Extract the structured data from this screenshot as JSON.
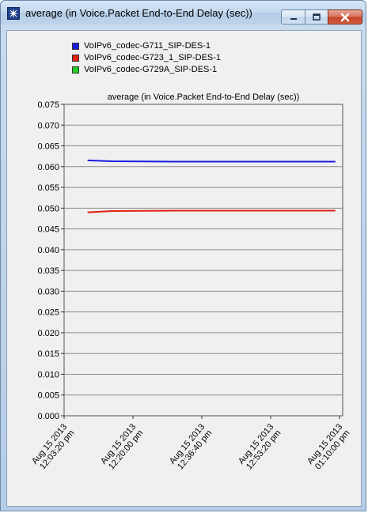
{
  "window": {
    "title": "average (in Voice.Packet End-to-End Delay (sec))",
    "icon": "app-window-icon",
    "controls": [
      "minimize-icon",
      "maximize-icon",
      "close-icon"
    ]
  },
  "legend": [
    {
      "name": "VoIPv6_codec-G711_SIP-DES-1",
      "color": "#1a1adf"
    },
    {
      "name": "VoIPv6_codec-G723_1_SIP-DES-1",
      "color": "#e02010"
    },
    {
      "name": "VoIPv6_codec-G729A_SIP-DES-1",
      "color": "#22cc22"
    }
  ],
  "chart_data": {
    "type": "line",
    "title": "average (in Voice.Packet End-to-End Delay (sec))",
    "xlabel": "",
    "ylabel": "",
    "ylim": [
      0,
      0.075
    ],
    "yticks": [
      "0.000",
      "0.005",
      "0.010",
      "0.015",
      "0.020",
      "0.025",
      "0.030",
      "0.035",
      "0.040",
      "0.045",
      "0.050",
      "0.055",
      "0.060",
      "0.065",
      "0.070",
      "0.075"
    ],
    "xticks": [
      {
        "date": "Aug 15 2013",
        "time": "12:03:20 pm"
      },
      {
        "date": "Aug 15 2013",
        "time": "12:20:00 pm"
      },
      {
        "date": "Aug 15 2013",
        "time": "12:36:40 pm"
      },
      {
        "date": "Aug 15 2013",
        "time": "12:53:20 pm"
      },
      {
        "date": "Aug 15 2013",
        "time": "01:10:00 pm"
      }
    ],
    "grid": "horizontal",
    "legend_position": "top",
    "series": [
      {
        "name": "VoIPv6_codec-G711_SIP-DES-1",
        "color": "#1a1adf",
        "x": [
          "12:09:00 pm",
          "12:15:00 pm",
          "12:30:00 pm",
          "12:45:00 pm",
          "01:00:00 pm",
          "01:09:00 pm"
        ],
        "values": [
          0.0615,
          0.0613,
          0.0612,
          0.0612,
          0.0612,
          0.0612
        ]
      },
      {
        "name": "VoIPv6_codec-G723_1_SIP-DES-1",
        "color": "#e02010",
        "x": [
          "12:09:00 pm",
          "12:15:00 pm",
          "12:30:00 pm",
          "12:45:00 pm",
          "01:00:00 pm",
          "01:09:00 pm"
        ],
        "values": [
          0.049,
          0.0493,
          0.0494,
          0.0494,
          0.0494,
          0.0494
        ]
      },
      {
        "name": "VoIPv6_codec-G729A_SIP-DES-1",
        "color": "#22cc22",
        "x": [],
        "values": []
      }
    ]
  }
}
